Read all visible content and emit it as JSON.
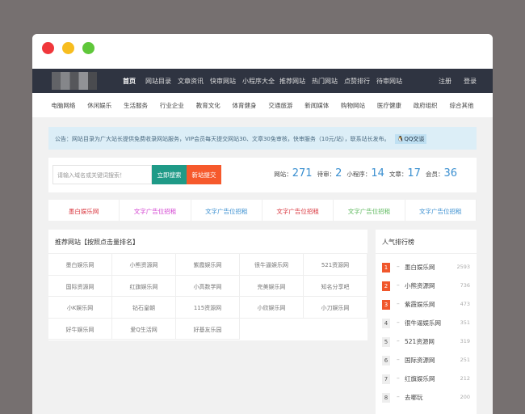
{
  "colors": {
    "nav_bg": "#2f3441",
    "search_btn": "#1f9a87",
    "submit_btn": "#f6592c",
    "stat": "#3a8fd0",
    "rank_top": "#f0572c"
  },
  "nav": {
    "items": [
      "首页",
      "网站目录",
      "文章资讯",
      "快审网站",
      "小程序大全",
      "推荐网站",
      "热门网站",
      "点赞排行",
      "待审网站"
    ],
    "register": "注册",
    "login": "登录"
  },
  "categories": [
    "电脑网络",
    "休闲娱乐",
    "生活服务",
    "行业企业",
    "教育文化",
    "体育健身",
    "交通旅游",
    "新闻媒体",
    "购物网站",
    "医疗健康",
    "政府组织",
    "综合其他"
  ],
  "notice": {
    "text": "公告：网站目录为广大站长提供免费收录网站服务，VIP会员每天提交网站30、文章30免审核，快审服务（10元/站），联系站长发布。",
    "qq": "QQ交谈"
  },
  "search": {
    "placeholder": "请输入域名或关键词搜索！",
    "search_btn": "立即搜索",
    "submit_btn": "新站提交"
  },
  "stats": [
    {
      "label": "网站：",
      "value": "271"
    },
    {
      "label": "待审：",
      "value": "2"
    },
    {
      "label": "小程序：",
      "value": "14"
    },
    {
      "label": "文章：",
      "value": "17"
    },
    {
      "label": "会员：",
      "value": "36"
    }
  ],
  "ads": [
    {
      "text": "墨白娱乐网",
      "color": "#d9363e"
    },
    {
      "text": "文字广告位招租",
      "color": "#d23fd0"
    },
    {
      "text": "文字广告位招租",
      "color": "#3a8fd0"
    },
    {
      "text": "文字广告位招租",
      "color": "#d9363e"
    },
    {
      "text": "文字广告位招租",
      "color": "#5cb85c"
    },
    {
      "text": "文字广告位招租",
      "color": "#3a8fd0"
    }
  ],
  "recommend": {
    "title": "推荐网站【按照点击量排名】",
    "sites": [
      "墨白娱乐网",
      "小熊资源网",
      "紫霞娱乐网",
      "很牛逼娱乐网",
      "521资源网",
      "国际资源网",
      "红旗娱乐网",
      "小高数学网",
      "完美娱乐网",
      "知名分享吧",
      "小K娱乐网",
      "钻石皇朝",
      "115资源网",
      "小欣娱乐网",
      "小刀娱乐网",
      "好牛娱乐网",
      "爱Q生活网",
      "好基友乐园"
    ]
  },
  "ranking": {
    "title": "人气排行榜",
    "items": [
      {
        "rank": "1",
        "name": "墨白娱乐网",
        "count": "2593"
      },
      {
        "rank": "2",
        "name": "小熊资源网",
        "count": "736"
      },
      {
        "rank": "3",
        "name": "紫霞娱乐网",
        "count": "473"
      },
      {
        "rank": "4",
        "name": "很牛逼娱乐网",
        "count": "351"
      },
      {
        "rank": "5",
        "name": "521资源网",
        "count": "319"
      },
      {
        "rank": "6",
        "name": "国际资源网",
        "count": "251"
      },
      {
        "rank": "7",
        "name": "红旗娱乐网",
        "count": "212"
      },
      {
        "rank": "8",
        "name": "去哪玩",
        "count": "200"
      }
    ]
  }
}
